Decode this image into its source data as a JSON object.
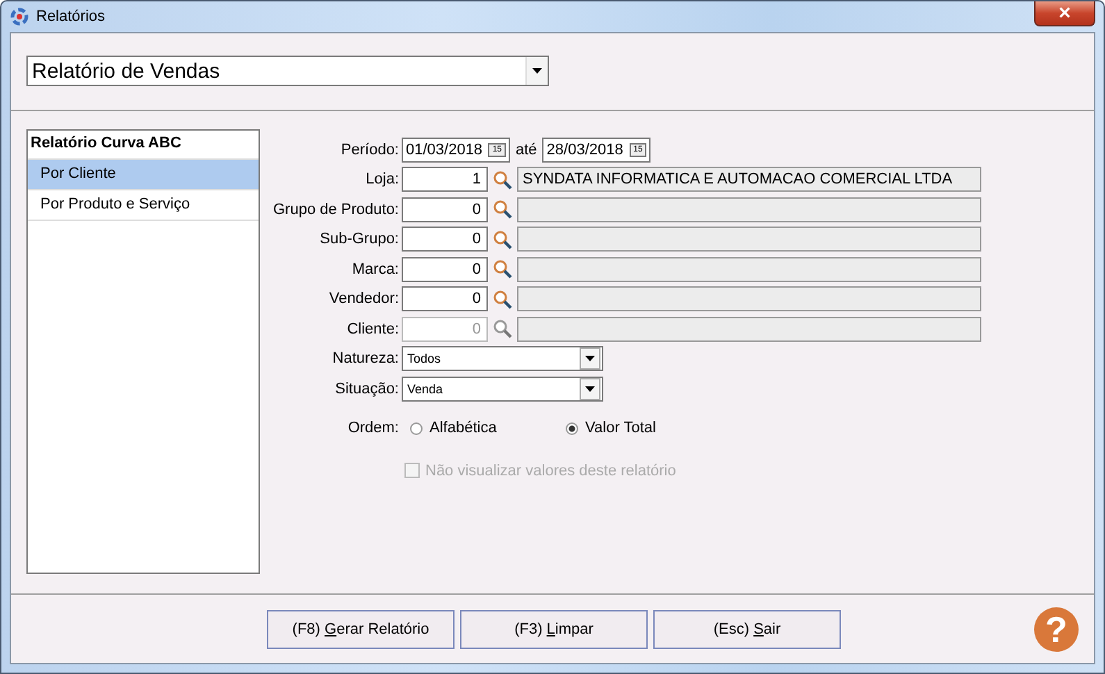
{
  "window": {
    "title": "Relatórios",
    "close": "×"
  },
  "report_select": {
    "value": "Relatório de Vendas"
  },
  "report_list": {
    "heading": "Relatório Curva ABC",
    "items": [
      {
        "label": "Por Cliente",
        "selected": true
      },
      {
        "label": "Por Produto e Serviço",
        "selected": false
      }
    ]
  },
  "period": {
    "label": "Período:",
    "from": "01/03/2018",
    "from_calendar_glyph": "15",
    "separator": "até",
    "to": "28/03/2018",
    "to_calendar_glyph": "15"
  },
  "lookups": [
    {
      "label": "Loja:",
      "code": "1",
      "description": "SYNDATA INFORMATICA E AUTOMACAO COMERCIAL LTDA",
      "disabled": false
    },
    {
      "label": "Grupo de Produto:",
      "code": "0",
      "disabled": false
    },
    {
      "label": "Sub-Grupo:",
      "code": "0",
      "disabled": false
    },
    {
      "label": "Marca:",
      "code": "0",
      "disabled": false
    },
    {
      "label": "Vendedor:",
      "code": "0",
      "disabled": false
    },
    {
      "label": "Cliente:",
      "code": "0",
      "disabled": true
    }
  ],
  "selects": [
    {
      "label": "Natureza:",
      "value": "Todos"
    },
    {
      "label": "Situação:",
      "value": "Venda"
    }
  ],
  "order": {
    "label": "Ordem:",
    "options": [
      {
        "label": "Alfabética",
        "selected": false
      },
      {
        "label": "Valor Total",
        "selected": true
      }
    ]
  },
  "hide_values": {
    "label": "Não visualizar valores deste relatório",
    "checked": false,
    "disabled": true
  },
  "buttons": [
    {
      "prefix": "(F8) ",
      "access_key": "G",
      "rest": "erar Relatório"
    },
    {
      "prefix": "(F3) ",
      "access_key": "L",
      "rest": "impar"
    },
    {
      "prefix": "(Esc) ",
      "access_key": "S",
      "rest": "air"
    }
  ],
  "help": {
    "glyph": "?"
  }
}
